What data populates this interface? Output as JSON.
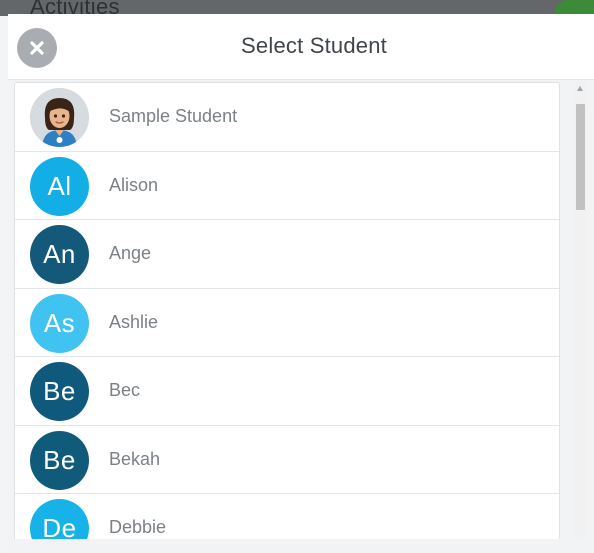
{
  "background": {
    "title": "Activities"
  },
  "modal": {
    "title": "Select Student",
    "close_icon": "close-x-icon"
  },
  "students": [
    {
      "name": "Sample Student",
      "initials": "",
      "avatar_type": "photo",
      "color": "#d8dde2"
    },
    {
      "name": "Alison",
      "initials": "Al",
      "avatar_type": "initials",
      "color": "#13aee6"
    },
    {
      "name": "Ange",
      "initials": "An",
      "avatar_type": "initials",
      "color": "#14587a"
    },
    {
      "name": "Ashlie",
      "initials": "As",
      "avatar_type": "initials",
      "color": "#41c3f2"
    },
    {
      "name": "Bec",
      "initials": "Be",
      "avatar_type": "initials",
      "color": "#0f5a7c"
    },
    {
      "name": "Bekah",
      "initials": "Be",
      "avatar_type": "initials",
      "color": "#105b7a"
    },
    {
      "name": "Debbie",
      "initials": "De",
      "avatar_type": "initials",
      "color": "#16b2e8"
    }
  ]
}
